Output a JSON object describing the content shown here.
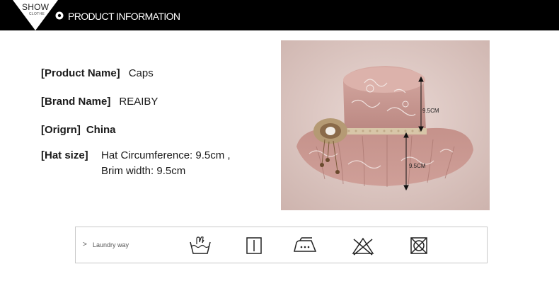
{
  "header": {
    "show_text": "SHOW",
    "clothe_text": "CLOTHE",
    "title": "PRODUCT INFORMATION"
  },
  "product": {
    "name_label": "[Product Name]",
    "name_value": "Caps",
    "brand_label": "[Brand Name]",
    "brand_value": "REAIBY",
    "origin_label": "[Origrn]",
    "origin_value": "China",
    "size_label": "[Hat size]",
    "size_line1": "Hat Circumference: 9.5cm ,",
    "size_line2": "Brim width: 9.5cm"
  },
  "photo": {
    "crown_measure": "9.5CM",
    "brim_measure": "9.5CM"
  },
  "laundry": {
    "chevron": ">",
    "label": "Laundry way",
    "icons": [
      "hand-wash-icon",
      "line-dry-icon",
      "iron-low-icon",
      "do-not-bleach-icon",
      "do-not-tumble-dry-icon"
    ]
  },
  "colors": {
    "header_bg": "#000000",
    "hat_pink": "#c99a93",
    "photo_bg": "#ddc9c4"
  }
}
